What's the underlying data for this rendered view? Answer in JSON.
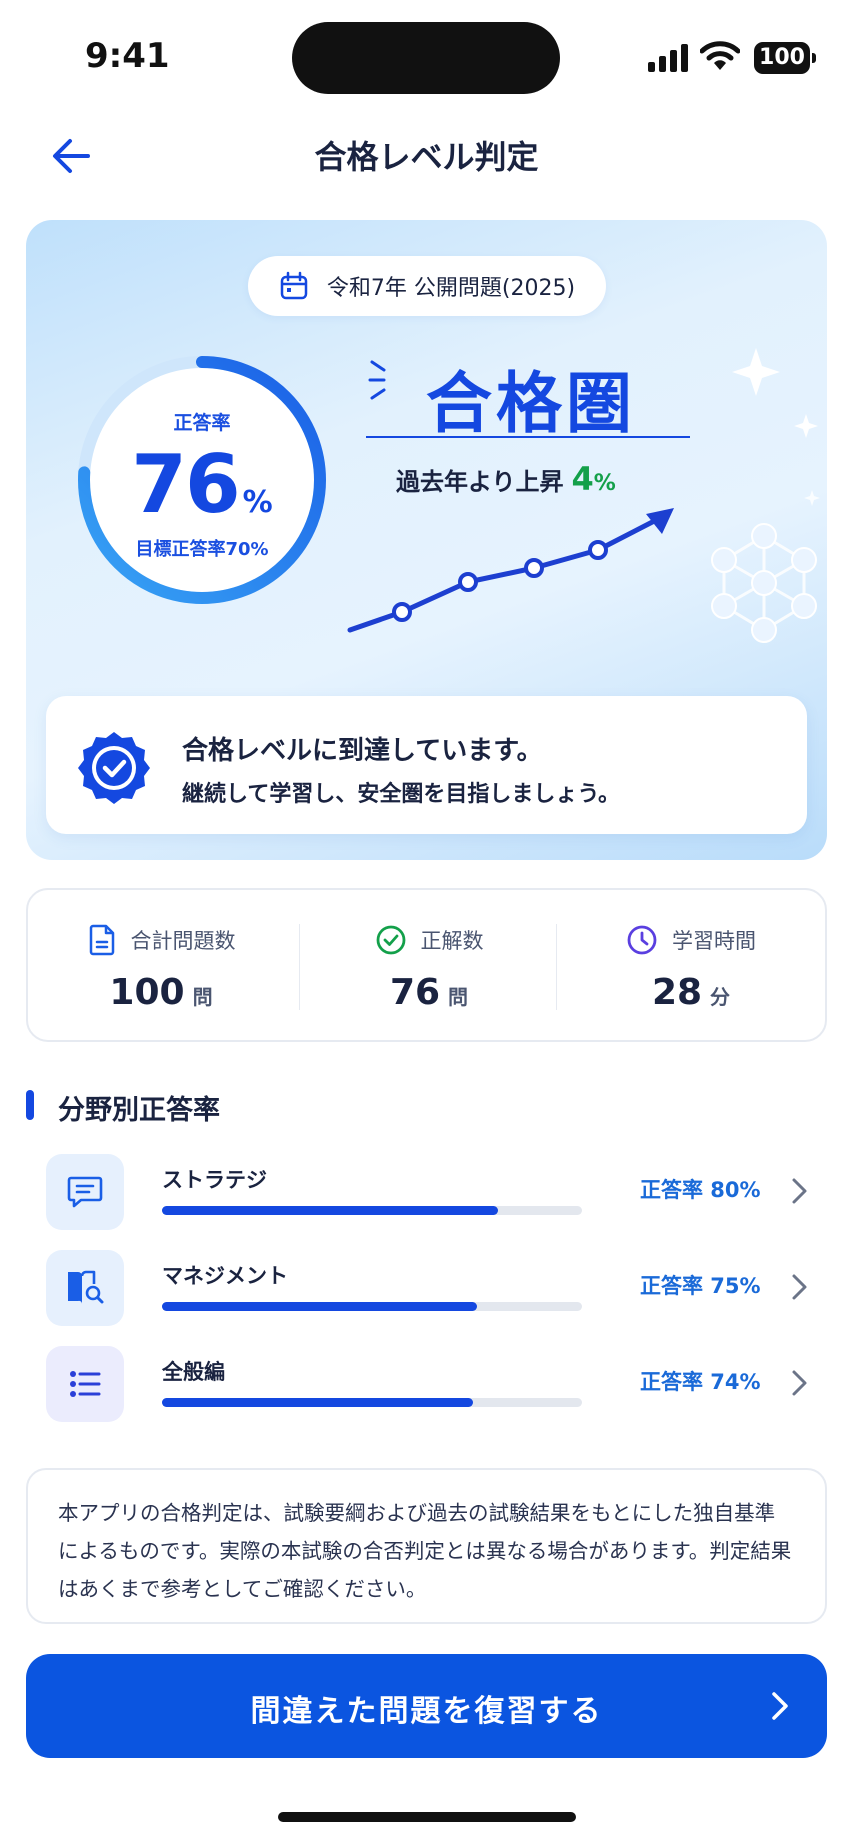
{
  "status_bar": {
    "time": "9:41",
    "battery": "100"
  },
  "header": {
    "title": "合格レベル判定"
  },
  "hero": {
    "exam_label": "令和7年 公開問題(2025)",
    "ring": {
      "label": "正答率",
      "value": "76",
      "unit": "%",
      "target": "目標正答率70%",
      "progress": 0.76
    },
    "verdict": "合格圏",
    "rise": {
      "text": "過去年より上昇",
      "value": "4",
      "unit": "%"
    },
    "message": {
      "title": "合格レベルに到達しています。",
      "subtitle": "継続して学習し、安全圏を目指しましょう。"
    }
  },
  "stats": [
    {
      "label": "合計問題数",
      "value": "100",
      "unit": "問",
      "icon": "document-icon"
    },
    {
      "label": "正解数",
      "value": "76",
      "unit": "問",
      "icon": "check-circle-icon"
    },
    {
      "label": "学習時間",
      "value": "28",
      "unit": "分",
      "icon": "clock-icon"
    }
  ],
  "fields": {
    "title": "分野別正答率",
    "items": [
      {
        "name": "ストラテジ",
        "rate_label": "正答率 80%",
        "rate": 0.8,
        "icon": "chat-icon"
      },
      {
        "name": "マネジメント",
        "rate_label": "正答率 75%",
        "rate": 0.75,
        "icon": "book-search-icon"
      },
      {
        "name": "全般編",
        "rate_label": "正答率 74%",
        "rate": 0.74,
        "icon": "list-icon"
      }
    ]
  },
  "disclaimer": "本アプリの合格判定は、試験要綱および過去の試験結果をもとにした独自基準によるものです。実際の本試験の合否判定とは異なる場合があります。判定結果はあくまで参考としてご確認ください。",
  "cta": {
    "label": "間違えた問題を復習する"
  },
  "colors": {
    "primary": "#1448e0",
    "success": "#13a04a",
    "cta": "#0b55e0"
  }
}
